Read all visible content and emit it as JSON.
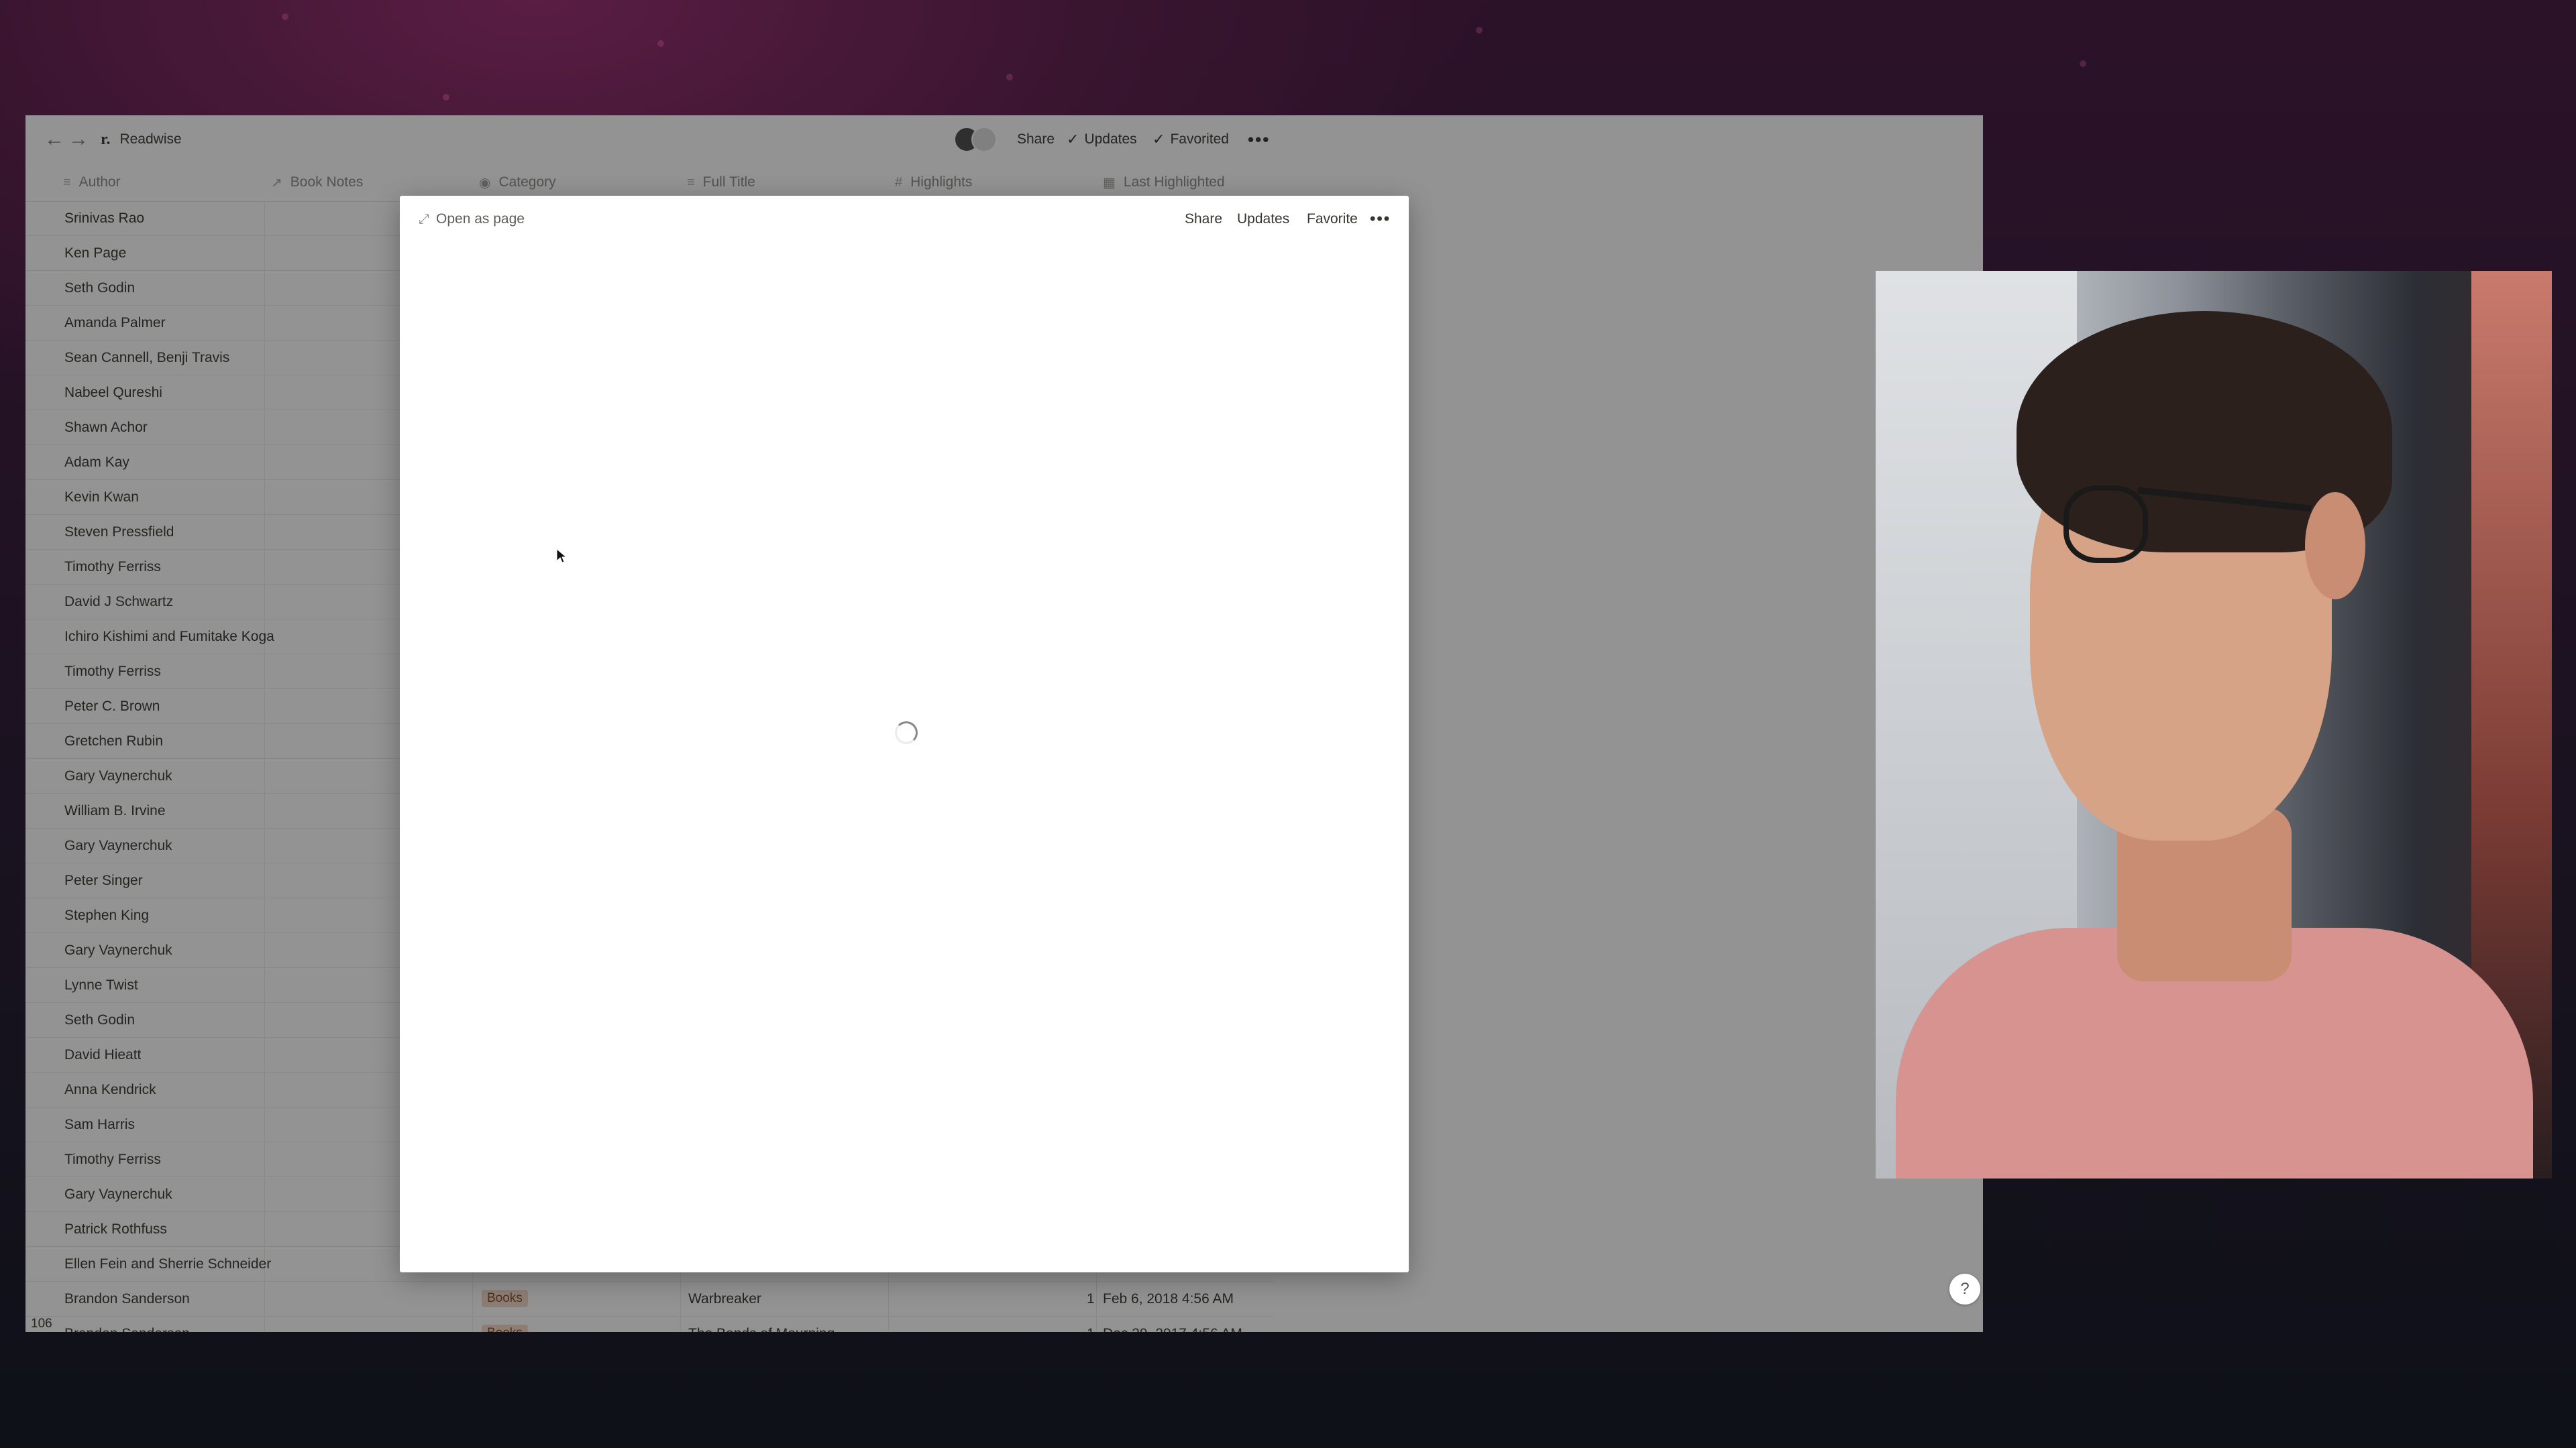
{
  "titlebar": {
    "breadcrumb_icon": "r.",
    "breadcrumb": "Readwise",
    "share": "Share",
    "updates": "Updates",
    "favorited": "Favorited",
    "more_icon": "more-horizontal-icon"
  },
  "columns": [
    {
      "label": "Author",
      "icon": "text-lines-icon"
    },
    {
      "label": "Book Notes",
      "icon": "relation-arrow-icon"
    },
    {
      "label": "Category",
      "icon": "select-icon"
    },
    {
      "label": "Full Title",
      "icon": "text-lines-icon"
    },
    {
      "label": "Highlights",
      "icon": "hash-icon"
    },
    {
      "label": "Last Highlighted",
      "icon": "calendar-icon"
    }
  ],
  "rows": [
    {
      "author": "Srinivas Rao"
    },
    {
      "author": "Ken Page"
    },
    {
      "author": "Seth Godin"
    },
    {
      "author": "Amanda Palmer"
    },
    {
      "author": "Sean Cannell, Benji Travis"
    },
    {
      "author": "Nabeel Qureshi"
    },
    {
      "author": "Shawn Achor"
    },
    {
      "author": "Adam Kay"
    },
    {
      "author": "Kevin Kwan"
    },
    {
      "author": "Steven Pressfield"
    },
    {
      "author": "Timothy Ferriss"
    },
    {
      "author": "David J Schwartz"
    },
    {
      "author": "Ichiro Kishimi and Fumitake Koga"
    },
    {
      "author": "Timothy Ferriss"
    },
    {
      "author": "Peter C. Brown"
    },
    {
      "author": "Gretchen Rubin"
    },
    {
      "author": "Gary Vaynerchuk"
    },
    {
      "author": "William B. Irvine"
    },
    {
      "author": "Gary Vaynerchuk"
    },
    {
      "author": "Peter Singer"
    },
    {
      "author": "Stephen King"
    },
    {
      "author": "Gary Vaynerchuk"
    },
    {
      "author": "Lynne Twist"
    },
    {
      "author": "Seth Godin"
    },
    {
      "author": "David Hieatt"
    },
    {
      "author": "Anna Kendrick"
    },
    {
      "author": "Sam Harris"
    },
    {
      "author": "Timothy Ferriss"
    },
    {
      "author": "Gary Vaynerchuk"
    },
    {
      "author": "Patrick Rothfuss"
    },
    {
      "author": "Ellen Fein and Sherrie Schneider"
    },
    {
      "author": "Brandon Sanderson",
      "category": "Books",
      "full_title": "Warbreaker",
      "highlights": "1",
      "last_highlighted": "Feb 6, 2018 4:56 AM"
    },
    {
      "author": "Brandon Sanderson",
      "category": "Books",
      "full_title": "The Bands of Mourning",
      "highlights": "1",
      "last_highlighted": "Dec 29, 2017 4:56 AM"
    }
  ],
  "footer_count": "106",
  "help_label": "?",
  "modal": {
    "open_as_page": "Open as page",
    "share": "Share",
    "updates": "Updates",
    "favorite": "Favorite",
    "more_icon": "more-horizontal-icon",
    "status": "loading"
  }
}
